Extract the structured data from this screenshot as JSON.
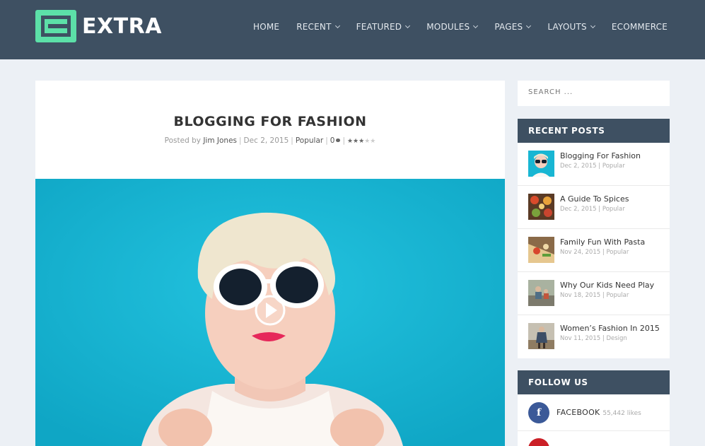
{
  "header": {
    "logo_text": "EXTRA",
    "nav": [
      {
        "label": "HOME",
        "dropdown": false
      },
      {
        "label": "RECENT",
        "dropdown": true
      },
      {
        "label": "FEATURED",
        "dropdown": true
      },
      {
        "label": "MODULES",
        "dropdown": true
      },
      {
        "label": "PAGES",
        "dropdown": true
      },
      {
        "label": "LAYOUTS",
        "dropdown": true
      },
      {
        "label": "ECOMMERCE",
        "dropdown": false
      }
    ]
  },
  "post": {
    "title": "BLOGGING FOR FASHION",
    "posted_by_prefix": "Posted by",
    "author": "Jim Jones",
    "date": "Dec 2, 2015",
    "category": "Popular",
    "comments": "0",
    "rating": 3,
    "rating_max": 5
  },
  "sidebar": {
    "search_placeholder": "SEARCH ...",
    "recent_posts_title": "RECENT POSTS",
    "recent_posts": [
      {
        "title": "Blogging For Fashion",
        "date": "Dec 2, 2015",
        "category": "Popular"
      },
      {
        "title": "A Guide To Spices",
        "date": "Dec 2, 2015",
        "category": "Popular"
      },
      {
        "title": "Family Fun With Pasta",
        "date": "Nov 24, 2015",
        "category": "Popular"
      },
      {
        "title": "Why Our Kids Need Play",
        "date": "Nov 18, 2015",
        "category": "Popular"
      },
      {
        "title": "Women’s Fashion In 2015",
        "date": "Nov 11, 2015",
        "category": "Design"
      }
    ],
    "follow_title": "FOLLOW US",
    "follow": [
      {
        "network": "FACEBOOK",
        "count": "55,442 likes",
        "icon": "facebook-icon"
      }
    ]
  },
  "colors": {
    "header_bg": "#3e5062",
    "accent": "#5ce0a8",
    "hero_bg": "#16b4d2",
    "facebook": "#3b5998"
  }
}
